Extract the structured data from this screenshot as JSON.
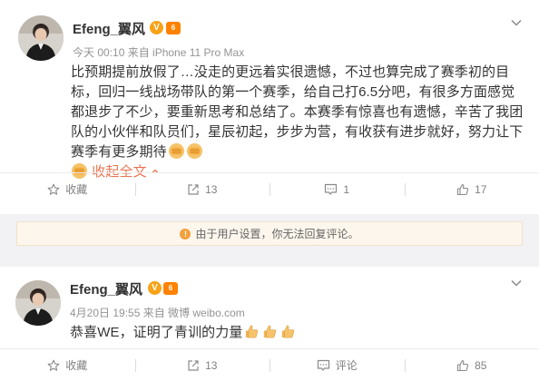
{
  "post1": {
    "username": "Efeng_翼风",
    "verified_mark": "V",
    "vip_mark": "6",
    "meta": "今天 00:10 来自 iPhone 11 Pro Max",
    "text": "比预期提前放假了…没走的更远着实很遗憾，不过也算完成了赛季初的目标，回归一线战场带队的第一个赛季，给自己打6.5分吧，有很多方面感觉都退步了不少，要重新思考和总结了。本赛季有惊喜也有遗憾，辛苦了我团队的小伙伴和队员们，星辰初起，步步为营，有收获有进步就好，努力让下赛季有更多期待",
    "collapse_label": "收起全文",
    "actions": {
      "favorite": "收藏",
      "repost": "13",
      "comment": "1",
      "like": "17"
    },
    "icons": [
      "avatar",
      "verified-icon",
      "vip-icon",
      "chevron-down-icon",
      "fist-emoji-icon",
      "star-icon",
      "repost-icon",
      "comment-icon",
      "like-icon"
    ]
  },
  "notice": {
    "text": "由于用户设置，你无法回复评论。"
  },
  "post2": {
    "username": "Efeng_翼风",
    "verified_mark": "V",
    "vip_mark": "6",
    "meta": "4月20日 19:55 来自 微博 weibo.com",
    "text": "恭喜WE，证明了青训的力量",
    "actions": {
      "favorite": "收藏",
      "repost": "13",
      "comment": "评论",
      "like": "85"
    },
    "icons": [
      "avatar",
      "verified-icon",
      "vip-icon",
      "chevron-down-icon",
      "thumbs-up-emoji-icon",
      "star-icon",
      "repost-icon",
      "comment-icon",
      "like-icon"
    ]
  },
  "colors": {
    "accent": "#eb7350",
    "verified": "#f8a216",
    "vip": "#ff8200",
    "notice_bg": "#fdf6ec"
  }
}
